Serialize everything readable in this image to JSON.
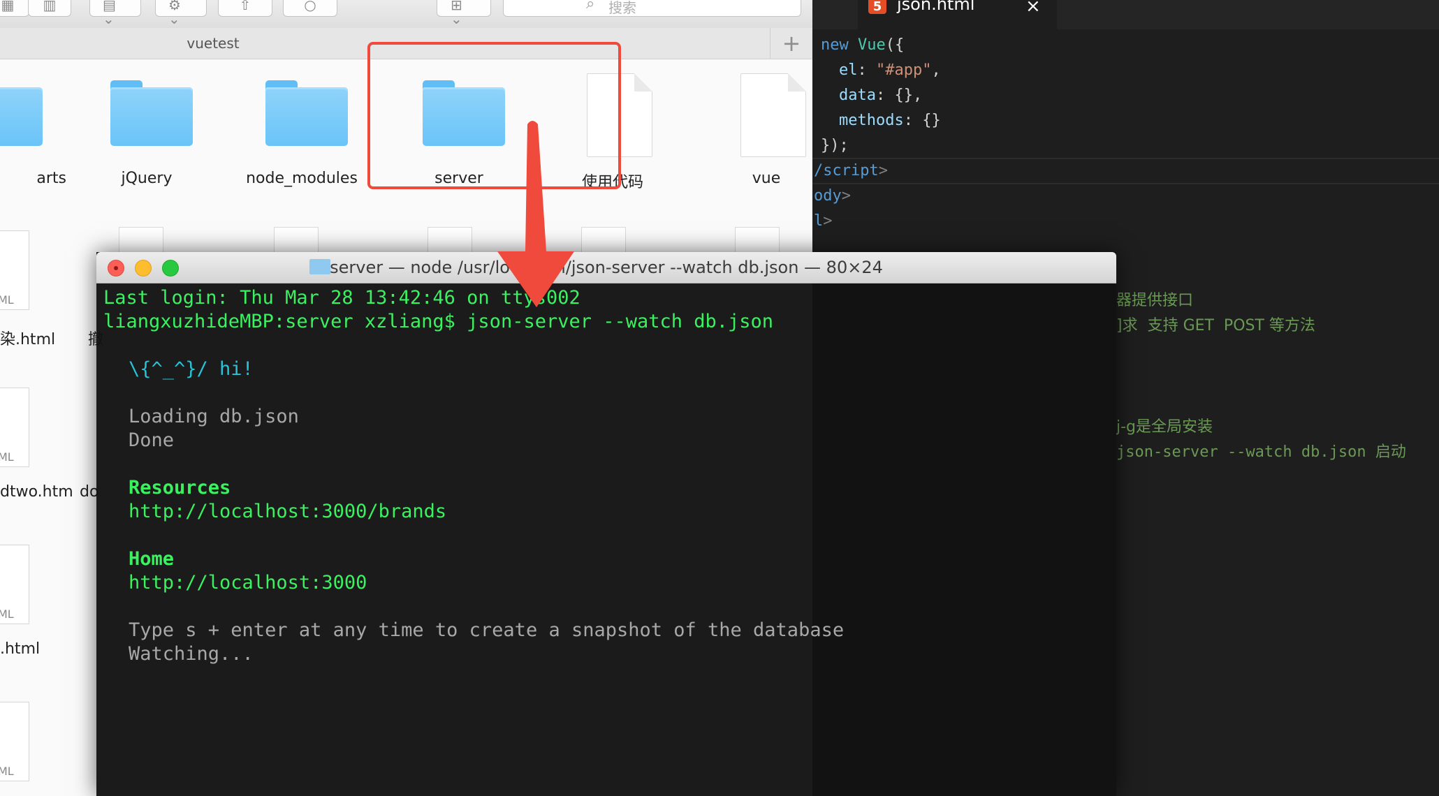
{
  "finder": {
    "path_title": "vuetest",
    "add_tab_label": "+",
    "search_placeholder": "搜索",
    "toolbar_glyphs": {
      "icon_view": "▦",
      "list_view": "☰",
      "column_view": "▥",
      "group": "▤ ⌄",
      "action": "⚙ ⌄",
      "share": "⇧",
      "tag": "○",
      "arrange": "⊞ ⌄"
    },
    "items_row1": [
      {
        "label": "arts",
        "kind": "folder"
      },
      {
        "label": "jQuery",
        "kind": "folder"
      },
      {
        "label": "node_modules",
        "kind": "folder"
      },
      {
        "label": "server",
        "kind": "folder"
      },
      {
        "label": "使用代码",
        "kind": "document"
      },
      {
        "label": "vue",
        "kind": "document"
      }
    ],
    "left_column_labels": [
      "染.html",
      "dtwo.htm",
      ".html"
    ],
    "left_column_partials": [
      "撤",
      "do"
    ],
    "doc_badge": "ML"
  },
  "editor": {
    "tab_name": "json.html",
    "tab_badge": "5",
    "tab_close": "×",
    "code": {
      "l1_kw": "new",
      "l1_cls": "Vue",
      "l1_rest": "({",
      "l2_prop": "el",
      "l2_sep": ": ",
      "l2_str": "\"#app\"",
      "l2_end": ",",
      "l3_prop": "data",
      "l3_rest": ": {},",
      "l4_prop": "methods",
      "l4_rest": ": {}",
      "l5": "});",
      "l6_tag": "/script",
      "l7_tag": "ody",
      "l8_tag": "l"
    },
    "comments": [
      "器提供接口",
      "]求  支持 GET  POST 等方法",
      "j-g是全局安装",
      "json-server --watch db.json 启动"
    ]
  },
  "terminal": {
    "title": "server — node /usr/local/bin/json-server --watch db.json — 80×24",
    "lines": {
      "last_login": "Last login: Thu Mar 28 13:42:46 on ttys002",
      "prompt": "liangxuzhideMBP:server xzliang$ json-server --watch db.json",
      "hi": "\\{^_^}/ hi!",
      "loading": "Loading db.json",
      "done": "Done",
      "resources_heading": "Resources",
      "resources_url": "http://localhost:3000/brands",
      "home_heading": "Home",
      "home_url": "http://localhost:3000",
      "snapshot_hint": "Type s + enter at any time to create a snapshot of the database",
      "watching": "Watching..."
    }
  },
  "colors": {
    "highlight_red": "#ef4a3c",
    "terminal_green": "#3bf15f",
    "terminal_cyan": "#27c3d8",
    "folder_blue": "#6ac4f7"
  }
}
